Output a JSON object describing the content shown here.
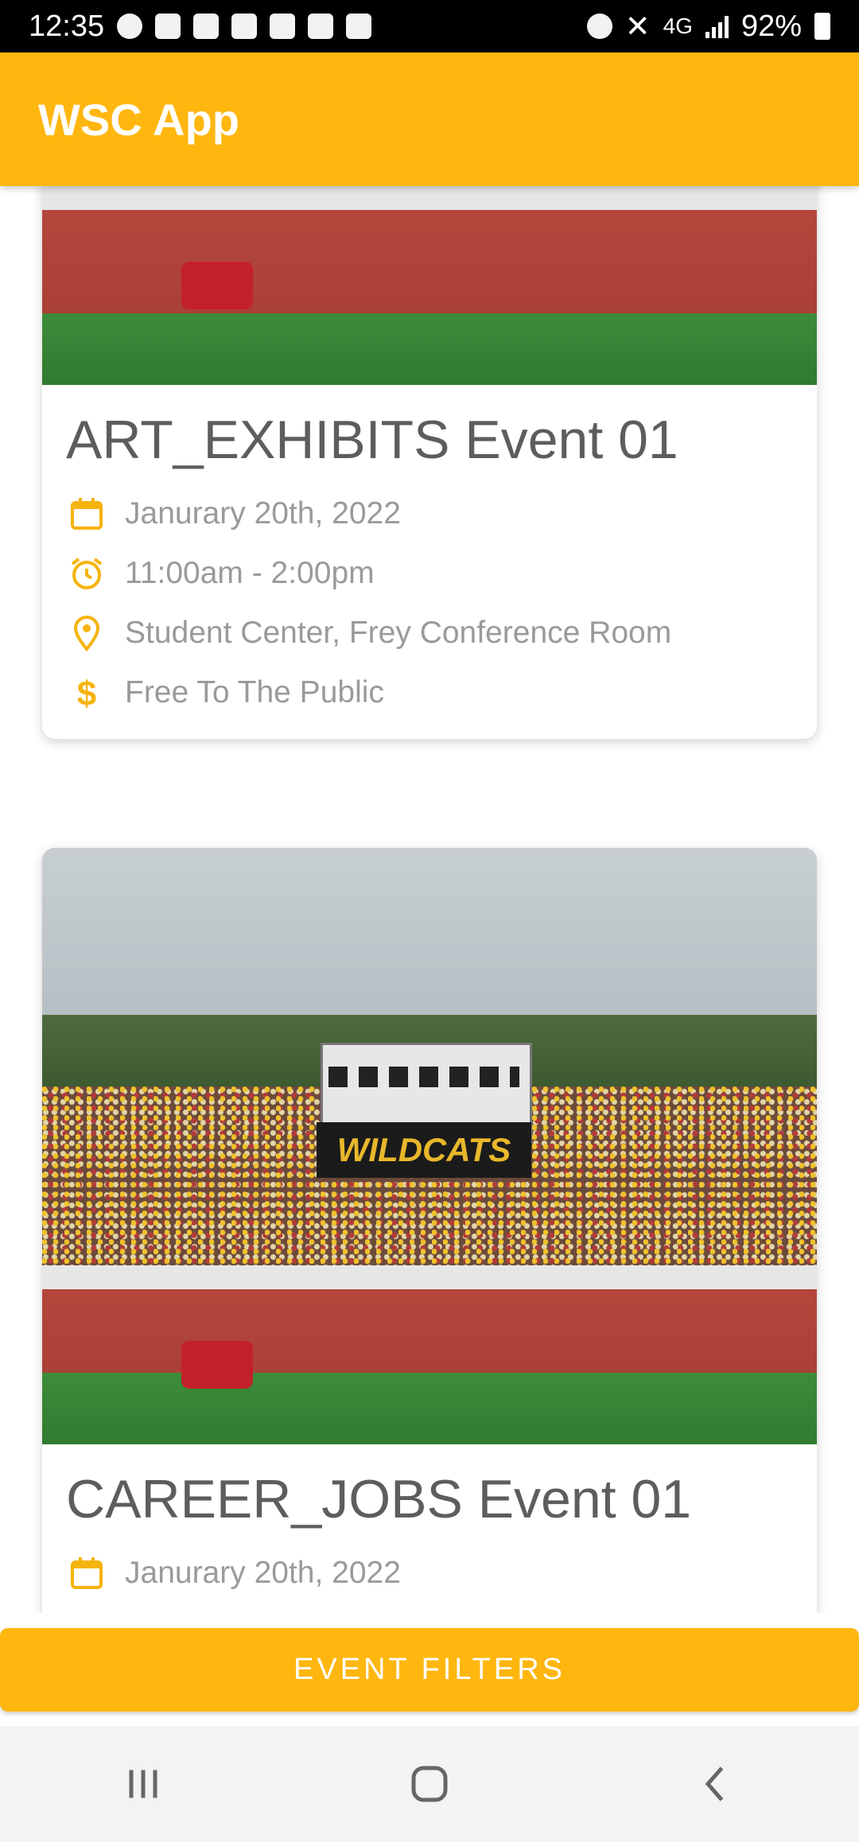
{
  "status_bar": {
    "time": "12:35",
    "battery": "92%",
    "network": "4G"
  },
  "app_bar": {
    "title": "WSC App"
  },
  "events": [
    {
      "title": "ART_EXHIBITS Event 01",
      "date": "Janurary 20th, 2022",
      "time": "11:00am - 2:00pm",
      "location": "Student Center, Frey Conference Room",
      "price": "Free To The Public"
    },
    {
      "title": "CAREER_JOBS Event 01",
      "date": "Janurary 20th, 2022",
      "banner_text": "WILDCATS"
    }
  ],
  "filters_button": {
    "label": "EVENT FILTERS"
  },
  "colors": {
    "accent": "#FFB60F",
    "icon": "#F5B30D",
    "text_title": "#5d5d5d",
    "text_detail": "#9a9a9a"
  },
  "icons": [
    "calendar-icon",
    "alarm-clock-icon",
    "location-pin-icon",
    "dollar-icon"
  ]
}
